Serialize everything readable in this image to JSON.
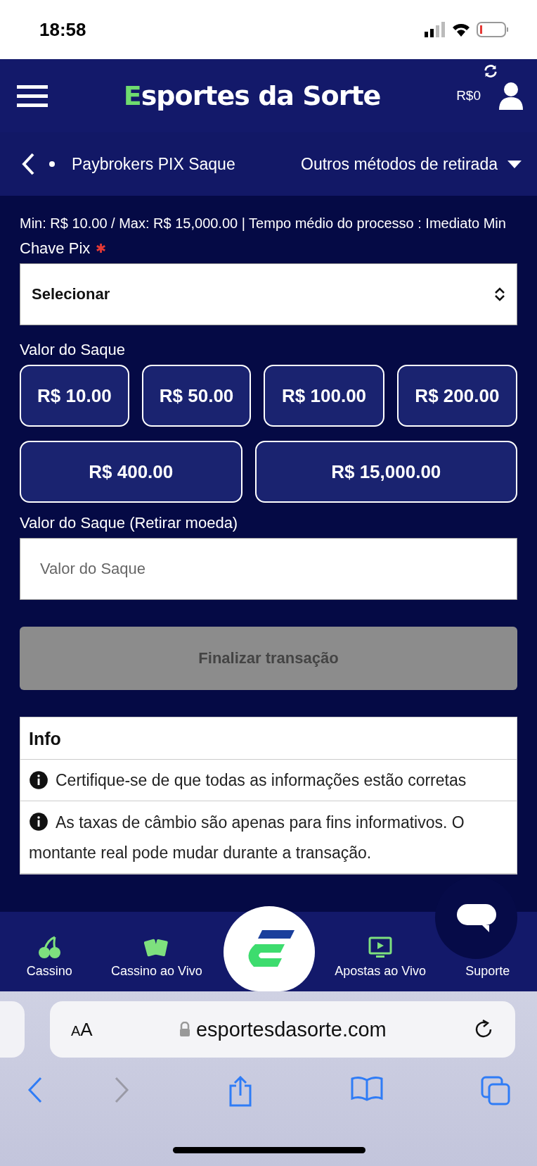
{
  "status_bar": {
    "time": "18:58"
  },
  "header": {
    "logo": "Esportes da Sorte",
    "balance": "R$0"
  },
  "subnav": {
    "method": "Paybrokers PIX Saque",
    "other_methods": "Outros métodos de retirada"
  },
  "limits_text": "Min: R$ 10.00 / Max: R$ 15,000.00 | Tempo médio do processo : Imediato Min",
  "pix_key": {
    "label": "Chave Pix",
    "required_mark": "✱",
    "value": "Selecionar"
  },
  "amount_label": "Valor do Saque",
  "amounts": [
    {
      "label": "R$ 10.00",
      "selected": false
    },
    {
      "label": "R$ 50.00",
      "selected": false
    },
    {
      "label": "R$ 100.00",
      "selected": false
    },
    {
      "label": "R$ 200.00",
      "selected": false
    },
    {
      "label": "R$ 400.00",
      "selected": false
    },
    {
      "label": "R$ 15,000.00",
      "selected": false
    }
  ],
  "withdraw_field": {
    "label": "Valor do Saque (Retirar moeda)",
    "placeholder": "Valor do Saque"
  },
  "submit": {
    "label": "Finalizar transação",
    "disabled": true
  },
  "info": {
    "title": "Info",
    "items": [
      "Certifique-se de que todas as informações estão corretas",
      "As taxas de câmbio são apenas para fins informativos. O montante real pode mudar durante a transação."
    ]
  },
  "bottom_nav": [
    {
      "label": "Cassino"
    },
    {
      "label": "Cassino ao Vivo"
    },
    {
      "label": "Apostas ao Vivo"
    },
    {
      "label": "Suporte"
    }
  ],
  "browser": {
    "text_size": "AA",
    "url": "esportesdasorte.com"
  }
}
